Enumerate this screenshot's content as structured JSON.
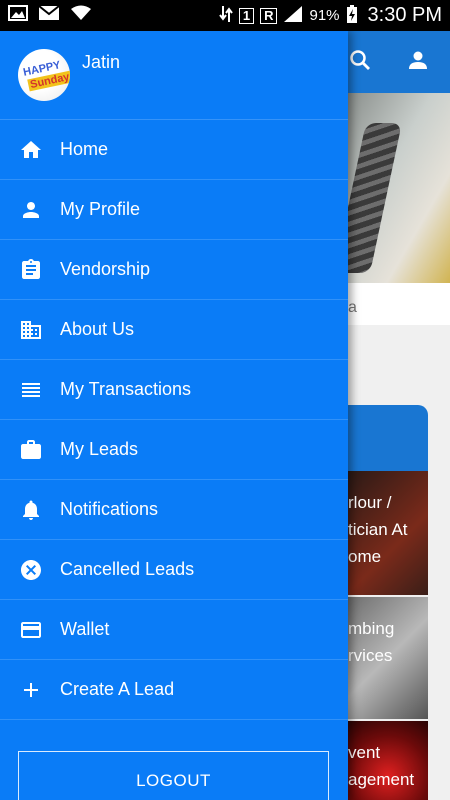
{
  "status_bar": {
    "battery": "91%",
    "time": "3:30 PM",
    "sim_badge": "1",
    "roaming_badge": "R"
  },
  "drawer": {
    "user_name": "Jatin",
    "avatar_text_line1": "HAPPY",
    "avatar_text_line2": "Sunday",
    "items": [
      {
        "label": "Home",
        "icon": "home-icon"
      },
      {
        "label": "My Profile",
        "icon": "person-icon"
      },
      {
        "label": "Vendorship",
        "icon": "clipboard-icon"
      },
      {
        "label": "About Us",
        "icon": "building-icon"
      },
      {
        "label": "My Transactions",
        "icon": "list-icon"
      },
      {
        "label": "My Leads",
        "icon": "briefcase-icon"
      },
      {
        "label": "Notifications",
        "icon": "bell-icon"
      },
      {
        "label": "Cancelled Leads",
        "icon": "cancel-circle-icon"
      },
      {
        "label": "Wallet",
        "icon": "card-icon"
      },
      {
        "label": "Create A Lead",
        "icon": "plus-icon"
      }
    ],
    "logout_label": "LOGOUT"
  },
  "background_screen": {
    "caption_fragment": "a",
    "tile1_text": "rlour / tician At ome",
    "tile2_text": "mbing rvices",
    "tile3_text": "vent agement"
  },
  "colors": {
    "drawer_blue": "#0a7cf7",
    "app_bar_blue": "#1976d2"
  }
}
